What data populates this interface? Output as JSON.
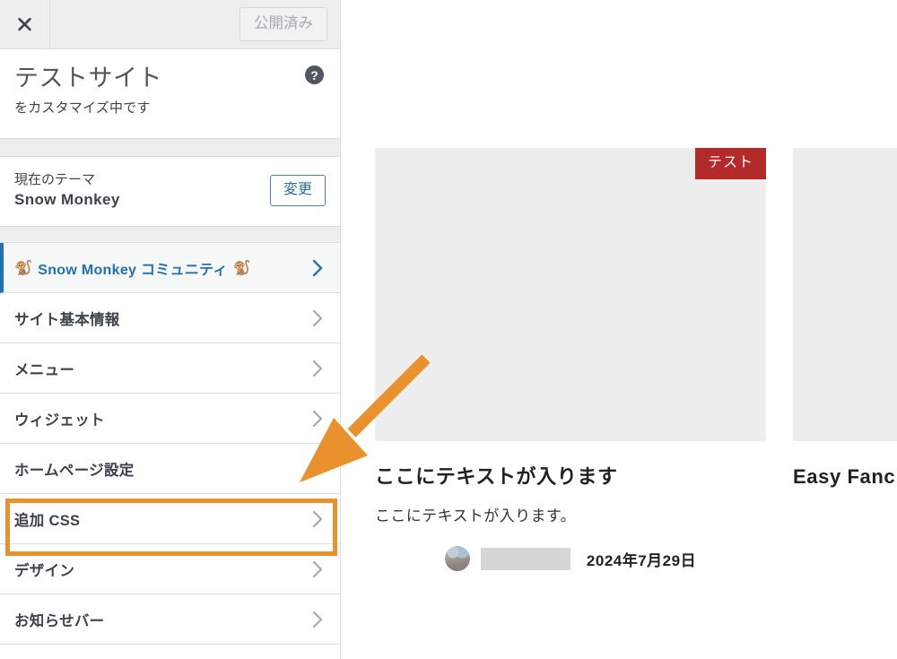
{
  "customizer": {
    "topbar": {
      "close_icon": "close-icon",
      "publish_label": "公開済み"
    },
    "site_header": {
      "site_name": "テストサイト",
      "subtitle": "をカスタマイズ中です",
      "help_icon_label": "?"
    },
    "theme_section": {
      "label": "現在のテーマ",
      "theme_name": "Snow Monkey",
      "change_label": "変更"
    },
    "nav_items": [
      {
        "label": "Snow Monkey コミュニティ",
        "emoji_left": "🐒",
        "emoji_right": "🐒",
        "accent": true
      },
      {
        "label": "サイト基本情報",
        "accent": false
      },
      {
        "label": "メニュー",
        "accent": false
      },
      {
        "label": "ウィジェット",
        "accent": false
      },
      {
        "label": "ホームページ設定",
        "accent": false
      },
      {
        "label": "追加 CSS",
        "accent": false,
        "highlighted": true
      },
      {
        "label": "デザイン",
        "accent": false
      },
      {
        "label": "お知らせバー",
        "accent": false
      }
    ]
  },
  "annotation": {
    "highlight_color": "#e8912d",
    "arrow_color": "#e8912d",
    "target_label": "追加 CSS"
  },
  "preview": {
    "cards": [
      {
        "badge": "テスト",
        "title": "ここにテキストが入ります",
        "excerpt": "ここにテキストが入ります。",
        "author": "",
        "date": "2024年7月29日"
      },
      {
        "title": "Easy Fanc",
        "excerpt": "",
        "author": "",
        "date": ""
      }
    ]
  },
  "colors": {
    "accent_blue": "#2271b1",
    "badge_red": "#b32a2a",
    "annotation_orange": "#e8912d",
    "sidebar_bg": "#ffffff",
    "topbar_bg": "#eeeeee",
    "thumb_gray": "#ededed"
  }
}
